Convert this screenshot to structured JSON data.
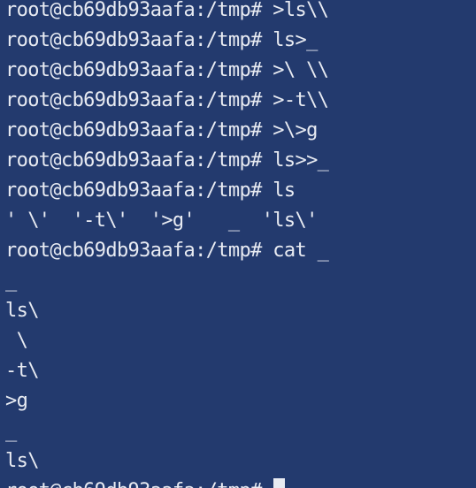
{
  "terminal": {
    "lines": [
      "root@cb69db93aafa:/tmp# >ls\\\\",
      "root@cb69db93aafa:/tmp# ls>_",
      "root@cb69db93aafa:/tmp# >\\ \\\\",
      "root@cb69db93aafa:/tmp# >-t\\\\",
      "root@cb69db93aafa:/tmp# >\\>g",
      "root@cb69db93aafa:/tmp# ls>>_",
      "root@cb69db93aafa:/tmp# ls",
      "' \\'  '-t\\'  '>g'   _  'ls\\'",
      "root@cb69db93aafa:/tmp# cat _",
      "_",
      "ls\\",
      " \\",
      "-t\\",
      ">g",
      "_",
      "ls\\"
    ],
    "current_prompt": "root@cb69db93aafa:/tmp# "
  }
}
